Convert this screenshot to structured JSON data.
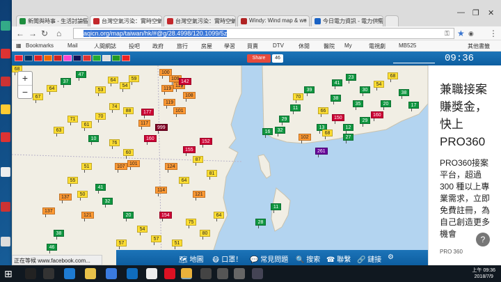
{
  "browser": {
    "tabs": [
      {
        "label": "新聞與時事 - 生活討論區",
        "color": "#1e8e3e"
      },
      {
        "label": "台灣空氣污染：實時空氣",
        "color": "#c3272b"
      },
      {
        "label": "台灣空氣污染：實時空氣",
        "color": "#c3272b"
      },
      {
        "label": "Windy: Wind map & we",
        "color": "#b02222"
      },
      {
        "label": "今日電力資訊 - 電力供需",
        "color": "#1a62c4"
      }
    ],
    "url_prefix": "aqicn.org/map/taiwan/hk/#@g/28.4998/120.1099/5z",
    "bookmarks": [
      "Bookmarks",
      "Mail",
      "人間網誌",
      "投吧",
      "政府",
      "旅行",
      "房屋",
      "學習",
      "買賣",
      "DTV",
      "休閒",
      "醫院",
      "My",
      "電視劇",
      "MB525",
      "其他書籤"
    ]
  },
  "site": {
    "flags": [
      "#e23",
      "#036",
      "#d22",
      "#e60",
      "#c22",
      "#f4c",
      "#115",
      "#d33",
      "#2a3",
      "#ddd",
      "#292",
      "#e22"
    ],
    "share_label": "Share",
    "share_count": "46",
    "time": "09:36"
  },
  "map": {
    "zoom_in": "+",
    "zoom_out": "−",
    "bar_items": [
      "地圖",
      "口罩！",
      "常見問題",
      "搜索",
      "聯繫",
      "鏈接"
    ],
    "status_url": "正在等候 www.facebook.com..."
  },
  "ad": {
    "headline": "兼職接案賺獎金，快上PRO360",
    "body": "PRO360接案平台，超過300 種以上專業需求，立即免費註冊，為自己創造更多機會",
    "source": "PRO 360"
  },
  "taskbar": {
    "time": "上午 09:36",
    "date": "2018/7/9"
  },
  "markers": [
    [
      "100",
      "o"
    ],
    [
      "109",
      "o"
    ],
    [
      "119",
      "o"
    ],
    [
      "142",
      "r"
    ],
    [
      "119",
      "o"
    ],
    [
      "108",
      "o"
    ],
    [
      "59",
      "y"
    ],
    [
      "54",
      "y"
    ],
    [
      "64",
      "y"
    ],
    [
      "53",
      "y"
    ],
    [
      "47",
      "g"
    ],
    [
      "37",
      "g"
    ],
    [
      "64",
      "y"
    ],
    [
      "67",
      "y"
    ],
    [
      "177",
      "r"
    ],
    [
      "999",
      "d"
    ],
    [
      "160",
      "r"
    ],
    [
      "155",
      "r"
    ],
    [
      "101",
      "o"
    ],
    [
      "119",
      "o"
    ],
    [
      "152",
      "r"
    ],
    [
      "117",
      "o"
    ],
    [
      "88",
      "y"
    ],
    [
      "74",
      "y"
    ],
    [
      "70",
      "y"
    ],
    [
      "61",
      "y"
    ],
    [
      "71",
      "y"
    ],
    [
      "63",
      "y"
    ],
    [
      "107",
      "o"
    ],
    [
      "101",
      "o"
    ],
    [
      "114",
      "o"
    ],
    [
      "154",
      "r"
    ],
    [
      "137",
      "o"
    ],
    [
      "137",
      "o"
    ],
    [
      "38",
      "g"
    ],
    [
      "46",
      "g"
    ],
    [
      "50",
      "y"
    ],
    [
      "41",
      "g"
    ],
    [
      "76",
      "y"
    ],
    [
      "60",
      "y"
    ],
    [
      "51",
      "y"
    ],
    [
      "55",
      "y"
    ],
    [
      "66",
      "y"
    ],
    [
      "150",
      "r"
    ],
    [
      "160",
      "r"
    ],
    [
      "13",
      "g"
    ],
    [
      "261",
      "p"
    ],
    [
      "68",
      "y"
    ],
    [
      "16",
      "g"
    ],
    [
      "102",
      "o"
    ],
    [
      "38",
      "g"
    ],
    [
      "70",
      "y"
    ],
    [
      "32",
      "g"
    ],
    [
      "29",
      "g"
    ],
    [
      "11",
      "g"
    ],
    [
      "39",
      "g"
    ],
    [
      "41",
      "g"
    ],
    [
      "23",
      "g"
    ],
    [
      "30",
      "g"
    ],
    [
      "54",
      "y"
    ],
    [
      "68",
      "y"
    ],
    [
      "38",
      "g"
    ],
    [
      "17",
      "g"
    ],
    [
      "35",
      "g"
    ],
    [
      "20",
      "g"
    ],
    [
      "29",
      "g"
    ],
    [
      "12",
      "g"
    ],
    [
      "27",
      "g"
    ],
    [
      "11",
      "g"
    ],
    [
      "28",
      "g"
    ],
    [
      "10",
      "g"
    ],
    [
      "32",
      "g"
    ],
    [
      "20",
      "g"
    ],
    [
      "121",
      "o"
    ],
    [
      "124",
      "o"
    ],
    [
      "64",
      "y"
    ],
    [
      "121",
      "o"
    ],
    [
      "81",
      "y"
    ],
    [
      "87",
      "y"
    ],
    [
      "64",
      "y"
    ],
    [
      "80",
      "y"
    ],
    [
      "75",
      "y"
    ],
    [
      "51",
      "y"
    ],
    [
      "57",
      "y"
    ],
    [
      "54",
      "y"
    ],
    [
      "57",
      "y"
    ],
    [
      "73",
      "y"
    ],
    [
      "69",
      "y"
    ],
    [
      "68",
      "y"
    ]
  ]
}
